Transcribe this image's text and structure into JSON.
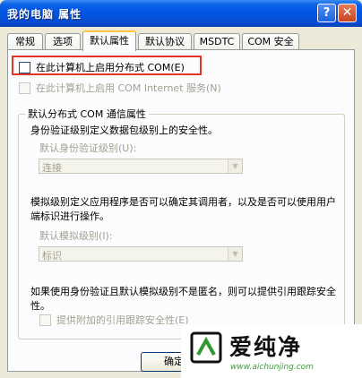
{
  "window": {
    "title": "我的电脑 属性",
    "help_label": "?",
    "close_label": "✕"
  },
  "tabs": [
    {
      "label": "常规"
    },
    {
      "label": "选项"
    },
    {
      "label": "默认属性",
      "active": true
    },
    {
      "label": "默认协议"
    },
    {
      "label": "MSDTC"
    },
    {
      "label": "COM 安全"
    }
  ],
  "options": {
    "enable_dcom": "在此计算机上启用分布式 COM(E)",
    "enable_com_internet": "在此计算机上启用 COM Internet 服务(N)"
  },
  "group": {
    "title": "默认分布式 COM 通信属性",
    "auth_desc": "身份验证级别定义数据包级别上的安全性。",
    "auth_label": "默认身份验证级别(U):",
    "auth_value": "连接",
    "impersonation_desc": "模拟级别定义应用程序是否可以确定其调用者，以及是否可以使用用户端标识进行操作。",
    "impersonation_label": "默认模拟级别(I):",
    "impersonation_value": "标识",
    "tracking_desc": "如果使用身份验证且默认模拟级别不是匿名，则可以提供引用跟踪安全性。",
    "tracking_checkbox": "提供附加的引用跟踪安全性(E)"
  },
  "buttons": {
    "ok": "确定"
  },
  "watermark": {
    "name": "爱纯净",
    "url": "www.aichunjing.com"
  },
  "colors": {
    "titlebar": "#0054e3",
    "highlight_box": "#e4342a",
    "active_tab_accent": "#ffc83c"
  }
}
